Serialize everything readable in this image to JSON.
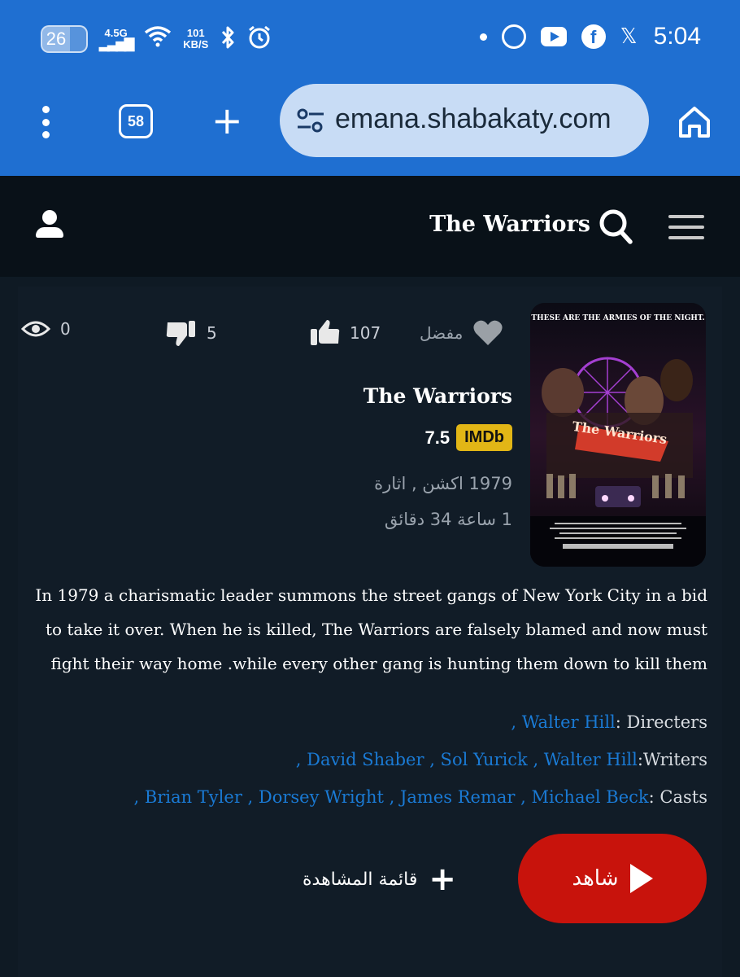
{
  "status_bar": {
    "battery": "26",
    "network": "4.5G",
    "speed_value": "101",
    "speed_unit": "KB/S",
    "time": "5:04"
  },
  "browser": {
    "tab_count": "58",
    "url": "emana.shabakaty.com"
  },
  "site_header": {
    "title": "The Warriors"
  },
  "stats": {
    "favorite_label": "مفضل",
    "likes": "107",
    "dislikes": "5",
    "views": "0"
  },
  "poster": {
    "tagline": "THESE ARE THE ARMIES OF THE NIGHT.",
    "title_art": "The Warriors"
  },
  "movie": {
    "title": "The Warriors",
    "rating": "7.5",
    "rating_source": "IMDb",
    "year_genres": "1979 اكشن , اثارة",
    "duration": "1 ساعة 34 دقائق",
    "description": "In 1979 a charismatic leader summons the street gangs of New York City in a bid to take it over. When he is killed, The Warriors are falsely blamed and now must fight their way home .while every other gang is hunting them down to kill them"
  },
  "credits": {
    "directors_label": "Directers",
    "directors": ", Walter Hill",
    "writers_label": "Writers",
    "writers": ", David Shaber , Sol Yurick , Walter Hill",
    "casts_label": "Casts",
    "casts": ", Brian Tyler , Dorsey Wright , James Remar , Michael Beck"
  },
  "actions": {
    "watch_label": "شاهد",
    "watchlist_label": "قائمة المشاهدة"
  },
  "colors": {
    "browser_bar": "#1f6fd1",
    "page_bg": "#0f1a24",
    "link": "#1a7ad4",
    "play_button": "#c8130c",
    "imdb_badge": "#e2b616"
  }
}
